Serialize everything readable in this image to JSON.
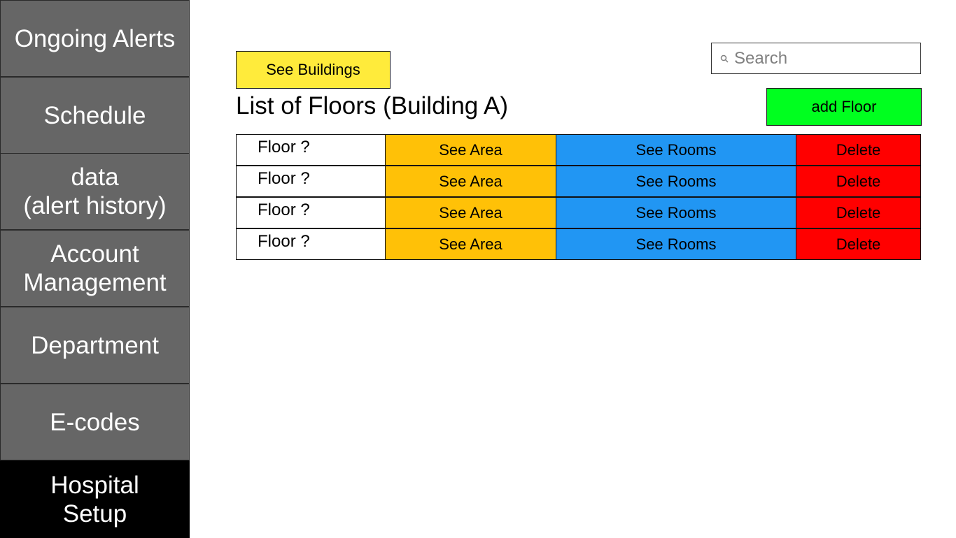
{
  "sidebar": {
    "items": [
      {
        "label": "Ongoing Alerts"
      },
      {
        "label": "Schedule"
      },
      {
        "label": "data\n(alert history)"
      },
      {
        "label": "Account\nManagement"
      },
      {
        "label": "Department"
      },
      {
        "label": "E-codes"
      },
      {
        "label": "Hospital\nSetup",
        "active": true
      }
    ]
  },
  "toolbar": {
    "see_buildings_label": "See Buildings",
    "add_floor_label": "add Floor"
  },
  "search": {
    "placeholder": "Search",
    "value": ""
  },
  "page": {
    "title": "List of Floors (Building A)"
  },
  "floors": {
    "rows": [
      {
        "name": "Floor ?",
        "area_label": "See Area",
        "rooms_label": "See Rooms",
        "delete_label": "Delete"
      },
      {
        "name": "Floor ?",
        "area_label": "See Area",
        "rooms_label": "See Rooms",
        "delete_label": "Delete"
      },
      {
        "name": "Floor ?",
        "area_label": "See Area",
        "rooms_label": "See Rooms",
        "delete_label": "Delete"
      },
      {
        "name": "Floor ?",
        "area_label": "See Area",
        "rooms_label": "See Rooms",
        "delete_label": "Delete"
      }
    ]
  },
  "colors": {
    "sidebar_bg": "#666666",
    "sidebar_active_bg": "#000000",
    "see_buildings": "#ffeb3b",
    "add_floor": "#00ff1f",
    "see_area": "#ffc107",
    "see_rooms": "#2196f3",
    "delete": "#ff0000"
  },
  "icons": {
    "search": "search-icon"
  }
}
